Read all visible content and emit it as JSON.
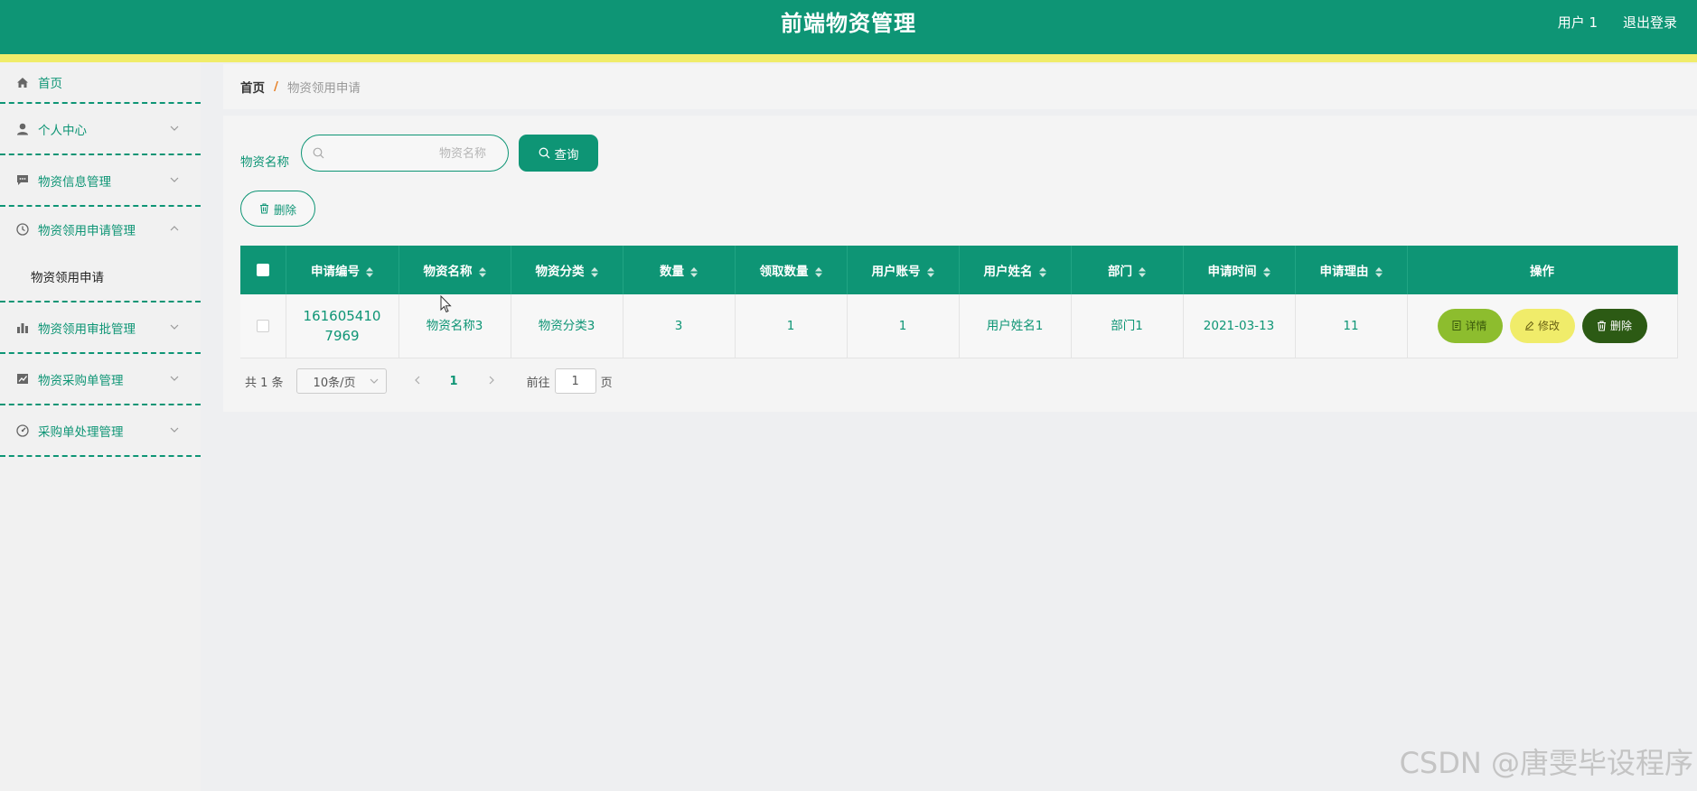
{
  "header": {
    "title": "前端物资管理",
    "user": "用户 1",
    "logout": "退出登录"
  },
  "sidebar": {
    "items": [
      {
        "label": "首页",
        "icon": "home-icon"
      },
      {
        "label": "个人中心",
        "icon": "user-icon"
      },
      {
        "label": "物资信息管理",
        "icon": "message-icon"
      },
      {
        "label": "物资领用申请管理",
        "icon": "clock-icon"
      },
      {
        "label": "物资领用审批管理",
        "icon": "bar-chart-icon"
      },
      {
        "label": "物资采购单管理",
        "icon": "line-chart-icon"
      },
      {
        "label": "采购单处理管理",
        "icon": "gauge-icon"
      }
    ],
    "submenu": {
      "label": "物资领用申请"
    }
  },
  "breadcrumb": {
    "home": "首页",
    "separator": "/",
    "current": "物资领用申请"
  },
  "search": {
    "label": "物资名称",
    "placeholder": "物资名称",
    "value": "",
    "button": "查询"
  },
  "actions": {
    "delete": "删除"
  },
  "table": {
    "columns": [
      "申请编号",
      "物资名称",
      "物资分类",
      "数量",
      "领取数量",
      "用户账号",
      "用户姓名",
      "部门",
      "申请时间",
      "申请理由",
      "操作"
    ],
    "rows": [
      {
        "apply_no": "1616054107969",
        "name": "物资名称3",
        "category": "物资分类3",
        "quantity": "3",
        "received": "1",
        "account": "1",
        "user_name": "用户姓名1",
        "dept": "部门1",
        "apply_time": "2021-03-13",
        "reason": "11",
        "ops": {
          "detail": "详情",
          "edit": "修改",
          "delete": "删除"
        }
      }
    ]
  },
  "pagination": {
    "total": "共 1 条",
    "page_size": "10条/页",
    "current_page": "1",
    "goto_prefix": "前往",
    "goto_value": "1",
    "goto_suffix": "页"
  },
  "watermark": "CSDN @唐雯毕设程序",
  "colors": {
    "primary": "#0e9575",
    "accent_yellow": "#f0ec6a",
    "detail_btn": "#8dbd2e",
    "delete_btn": "#2c5a14"
  }
}
